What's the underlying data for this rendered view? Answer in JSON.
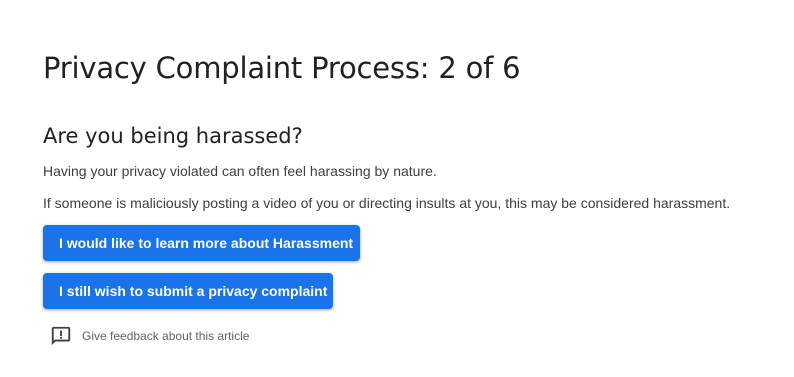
{
  "header": {
    "title": "Privacy Complaint Process: 2 of 6"
  },
  "section": {
    "heading": "Are you being harassed?",
    "paragraphs": [
      "Having your privacy violated can often feel harassing by nature.",
      "If someone is maliciously posting a video of you or directing insults at you, this may be considered harassment."
    ]
  },
  "actions": {
    "learn_more_label": "I would like to learn more about Harassment",
    "submit_complaint_label": "I still wish to submit a privacy complaint"
  },
  "feedback": {
    "icon": "feedback-icon",
    "label": "Give feedback about this article"
  },
  "colors": {
    "accent": "#1a73e8",
    "text": "#202124",
    "secondary_text": "#5f6368"
  }
}
